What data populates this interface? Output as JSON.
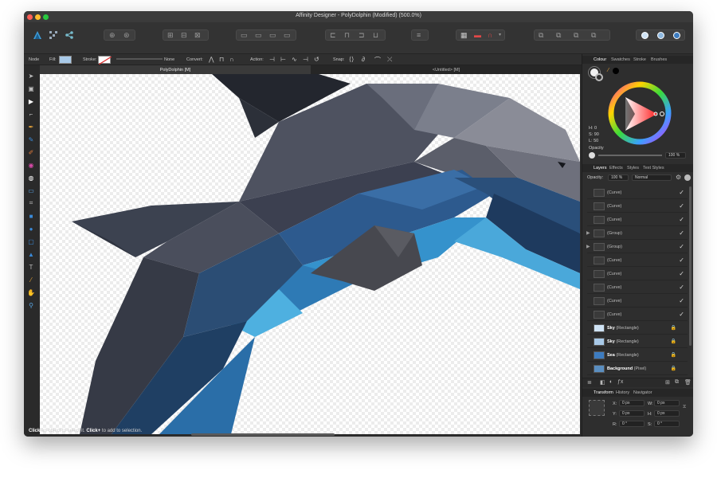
{
  "window": {
    "title": "Affinity Designer - PolyDolphin (Modified) (500.0%)"
  },
  "context_bar": {
    "mode": "Node",
    "fill_label": "Fill:",
    "stroke_label": "Stroke:",
    "stroke_value": "None",
    "convert_label": "Convert:",
    "action_label": "Action:",
    "snap_label": "Snap:",
    "fill_color": "#a8c9e8"
  },
  "document_tabs": [
    {
      "label": "PolyDolphin [M]",
      "active": true
    },
    {
      "label": "<Untitled> [M]",
      "active": false
    }
  ],
  "color_panel": {
    "tabs": [
      "Colour",
      "Swatches",
      "Stroke",
      "Brushes"
    ],
    "active_tab": "Colour",
    "hsl": {
      "h": "H: 0",
      "s": "S: 90",
      "l": "L: 50"
    },
    "opacity_label": "Opacity",
    "opacity_value": "100 %"
  },
  "layers_panel": {
    "tabs": [
      "Layers",
      "Effects",
      "Styles",
      "Text Styles"
    ],
    "active_tab": "Layers",
    "opacity_label": "Opacity:",
    "opacity_value": "100 %",
    "blend_mode": "Normal",
    "items": [
      {
        "bold": "",
        "name": "(Curve)",
        "expand": false,
        "locked": false,
        "visible": true
      },
      {
        "bold": "",
        "name": "(Curve)",
        "expand": false,
        "locked": false,
        "visible": true
      },
      {
        "bold": "",
        "name": "(Curve)",
        "expand": false,
        "locked": false,
        "visible": true
      },
      {
        "bold": "",
        "name": "(Group)",
        "expand": true,
        "locked": false,
        "visible": true
      },
      {
        "bold": "",
        "name": "(Group)",
        "expand": true,
        "locked": false,
        "visible": true
      },
      {
        "bold": "",
        "name": "(Curve)",
        "expand": false,
        "locked": false,
        "visible": true
      },
      {
        "bold": "",
        "name": "(Curve)",
        "expand": false,
        "locked": false,
        "visible": true
      },
      {
        "bold": "",
        "name": "(Curve)",
        "expand": false,
        "locked": false,
        "visible": true
      },
      {
        "bold": "",
        "name": "(Curve)",
        "expand": false,
        "locked": false,
        "visible": true
      },
      {
        "bold": "",
        "name": "(Curve)",
        "expand": false,
        "locked": false,
        "visible": true
      },
      {
        "bold": "Sky",
        "name": " (Rectangle)",
        "expand": false,
        "locked": true,
        "visible": false
      },
      {
        "bold": "Sky",
        "name": " (Rectangle)",
        "expand": false,
        "locked": true,
        "visible": false
      },
      {
        "bold": "Sea",
        "name": " (Rectangle)",
        "expand": false,
        "locked": true,
        "visible": false
      },
      {
        "bold": "Background",
        "name": " (Pixel)",
        "expand": false,
        "locked": true,
        "visible": false
      }
    ]
  },
  "transform_panel": {
    "tabs": [
      "Transform",
      "History",
      "Navigator"
    ],
    "active_tab": "Transform",
    "fields": {
      "x": "0 px",
      "y": "0 px",
      "w": "0 px",
      "h": "0 px",
      "r": "0 °",
      "s": "0 °"
    },
    "labels": {
      "x": "X:",
      "y": "Y:",
      "w": "W:",
      "h": "H:",
      "r": "R:",
      "s": "S:"
    }
  },
  "status_bar": {
    "bold1": "Click",
    "text1": " an object to select it. ",
    "bold2": "Click+",
    "text2": " to add to selection."
  },
  "icons": {
    "toolbar": [
      "persona-designer-icon",
      "persona-pixel-icon",
      "persona-export-icon"
    ],
    "tools": [
      "move-tool-icon",
      "artboard-tool-icon",
      "node-tool-icon",
      "corner-tool-icon",
      "pen-tool-icon",
      "pencil-tool-icon",
      "vector-brush-icon",
      "fill-tool-icon",
      "transparency-tool-icon",
      "place-image-icon",
      "crop-tool-icon",
      "rectangle-tool-icon",
      "ellipse-tool-icon",
      "rounded-rect-icon",
      "triangle-tool-icon",
      "text-tool-icon",
      "hand-tool-icon",
      "zoom-tool-icon"
    ]
  }
}
